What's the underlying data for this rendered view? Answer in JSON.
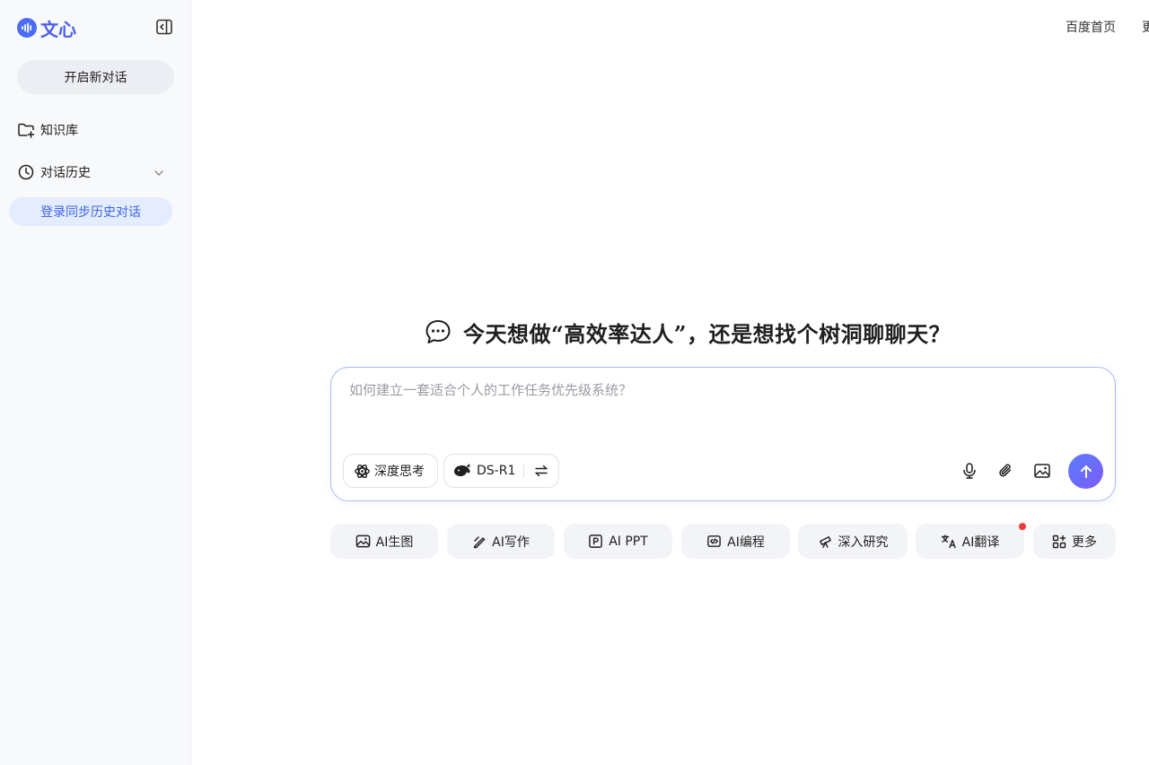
{
  "sidebar": {
    "logo_text": "文心",
    "new_chat_label": "开启新对话",
    "knowledge_base_label": "知识库",
    "history_label": "对话历史",
    "login_sync_label": "登录同步历史对话"
  },
  "topbar": {
    "baidu_home_label": "百度首页",
    "more_label_partial": "更"
  },
  "main": {
    "greeting": "今天想做“高效率达人”，还是想找个树洞聊聊天？",
    "composer": {
      "placeholder": "如何建立一套适合个人的工作任务优先级系统？",
      "deep_think_label": "深度思考",
      "model_label": "DS-R1"
    },
    "quick_actions": [
      {
        "label": "AI生图",
        "icon": "image-generate-icon"
      },
      {
        "label": "AI写作",
        "icon": "pen-icon"
      },
      {
        "label": "AI PPT",
        "icon": "slides-icon"
      },
      {
        "label": "AI编程",
        "icon": "code-icon"
      },
      {
        "label": "深入研究",
        "icon": "telescope-icon"
      },
      {
        "label": "AI翻译",
        "icon": "translate-icon",
        "badge": "red-dot"
      },
      {
        "label": "更多",
        "icon": "apps-grid-icon"
      }
    ]
  },
  "colors": {
    "accent": "#4a5ff0",
    "composer_border": "#aab8f7",
    "login_sync_bg": "#e3edff",
    "badge_red": "#f03a3a"
  }
}
